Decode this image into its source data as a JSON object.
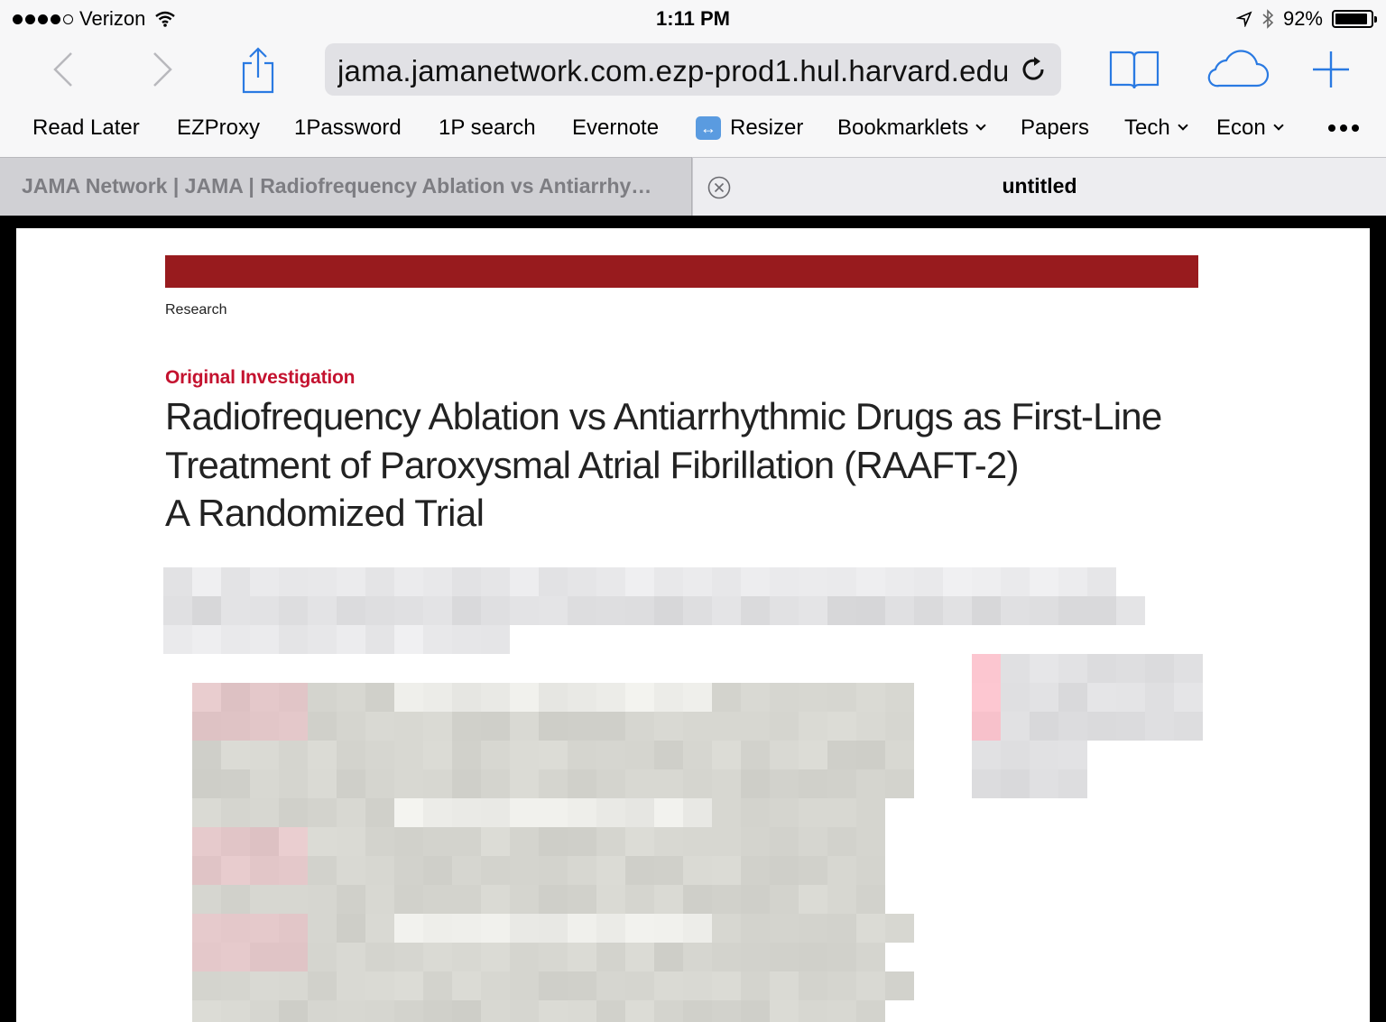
{
  "status_bar": {
    "carrier": "Verizon",
    "time": "1:11 PM",
    "battery_percent": "92%",
    "battery_level": 0.92
  },
  "toolbar": {
    "url": "jama.jamanetwork.com.ezp-prod1.hul.harvard.edu",
    "icons": [
      "back-icon",
      "forward-icon",
      "share-icon",
      "reload-icon",
      "bookmarks-icon",
      "icloud-tabs-icon",
      "new-tab-icon"
    ]
  },
  "bookmarks_bar": {
    "items": [
      {
        "label": "Read Later"
      },
      {
        "label": "EZProxy"
      },
      {
        "label": "1Password"
      },
      {
        "label": "1P search"
      },
      {
        "label": "Evernote"
      },
      {
        "label": "Resizer",
        "icon": "↔"
      },
      {
        "label": "Bookmarklets",
        "folder": true
      },
      {
        "label": "Papers"
      },
      {
        "label": "Tech",
        "folder": true
      },
      {
        "label": "Econ",
        "folder": true
      }
    ]
  },
  "tabs": [
    {
      "label": "JAMA Network | JAMA | Radiofrequency Ablation vs Antiarrhy…",
      "active": false
    },
    {
      "label": "untitled",
      "active": true
    }
  ],
  "article": {
    "section": "Research",
    "type": "Original Investigation",
    "title": "Radiofrequency Ablation vs Antiarrhythmic Drugs as First-Line Treatment of Paroxysmal Atrial Fibrillation (RAAFT-2)",
    "subtitle": "A Randomized Trial",
    "brand_color": "#981b1e",
    "accent_color": "#c4122f"
  }
}
